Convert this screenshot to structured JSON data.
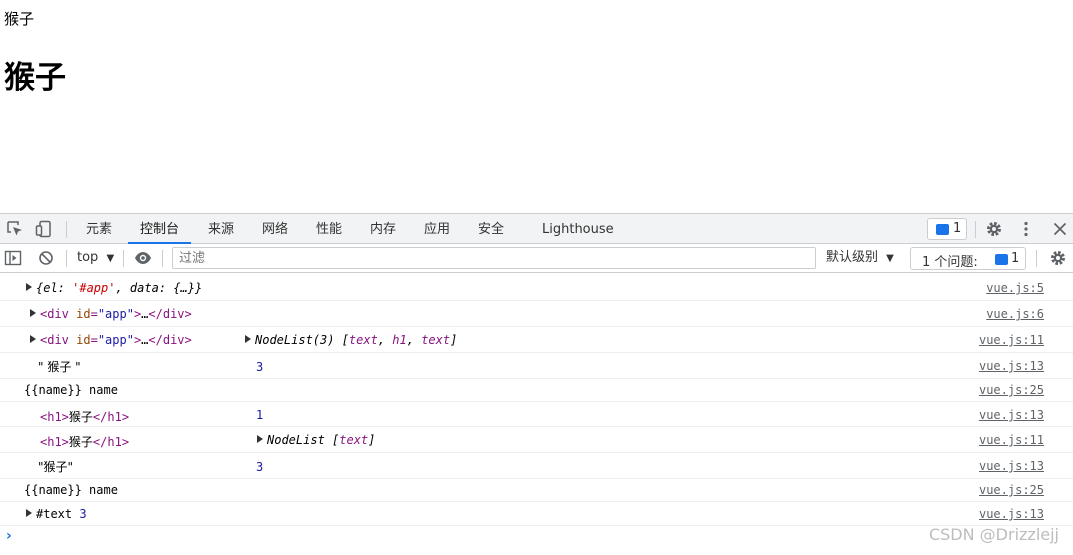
{
  "page": {
    "text": "猴子",
    "heading": "猴子"
  },
  "tabs": [
    {
      "label": "元素"
    },
    {
      "label": "控制台"
    },
    {
      "label": "来源"
    },
    {
      "label": "网络"
    },
    {
      "label": "性能"
    },
    {
      "label": "内存"
    },
    {
      "label": "应用"
    },
    {
      "label": "安全"
    },
    {
      "label": "Lighthouse"
    }
  ],
  "tabbar": {
    "message_count": "1"
  },
  "toolbar": {
    "context": "top",
    "filter_placeholder": "过滤",
    "level": "默认级别",
    "issues_label": "1 个问题:",
    "issues_count": "1"
  },
  "console": {
    "rows": [
      {
        "key": "{el: ",
        "str": "'#app'",
        "rest": ", data: {…}}",
        "src": "vue.js:5"
      },
      {
        "src": "vue.js:6"
      },
      {
        "nodelist_a": "NodeList(3) [",
        "items": [
          "text",
          "h1",
          "text"
        ],
        "src": "vue.js:11"
      },
      {
        "text": "\" 猴子 \"",
        "num": "3",
        "src": "vue.js:13"
      },
      {
        "text": "{{name}} name",
        "src": "vue.js:25"
      },
      {
        "inner": "猴子",
        "num": "1",
        "src": "vue.js:13"
      },
      {
        "inner": "猴子",
        "nodelist": "NodeList [",
        "item": "text",
        "src": "vue.js:11"
      },
      {
        "text": "\"猴子\"",
        "num": "3",
        "src": "vue.js:13"
      },
      {
        "text": "{{name}} name",
        "src": "vue.js:25"
      },
      {
        "text": "#text",
        "num": "3",
        "src": "vue.js:13"
      }
    ]
  },
  "watermark": "CSDN @Drizzlejj"
}
